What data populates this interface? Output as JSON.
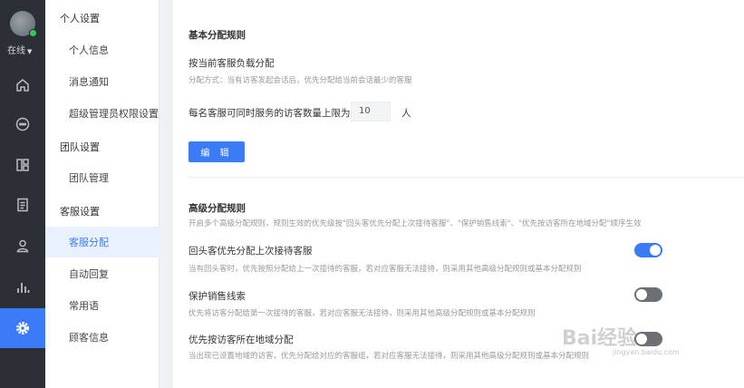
{
  "nav": {
    "status": "在线",
    "items": [
      "home-icon",
      "chat-icon",
      "dashboard-icon",
      "document-icon",
      "user-icon",
      "stats-icon",
      "settings-icon"
    ],
    "accent": "#3b7cf6"
  },
  "sidebar": {
    "groups": [
      {
        "label": "个人设置",
        "items": [
          "个人信息",
          "消息通知",
          "超级管理员权限设置"
        ]
      },
      {
        "label": "团队设置",
        "items": [
          "团队管理"
        ]
      },
      {
        "label": "客服设置",
        "items": [
          "客服分配",
          "自动回复",
          "常用语",
          "顾客信息"
        ]
      }
    ],
    "active": "客服分配"
  },
  "main": {
    "basic_title": "基本分配规则",
    "load_title": "按当前客服负载分配",
    "load_desc": "分配方式：当有访客发起会话后，优先分配给当前会话最少的客服",
    "limit_label": "每名客服可同时服务的访客数量上限为",
    "limit_value": "10",
    "limit_unit": "人",
    "edit_button": "编 辑",
    "advanced_title": "高级分配规则",
    "advanced_desc": "开启多个高级分配规则，规则生效的优先级按\"回头客优先分配上次接待客服\"、\"保护销售线索\"、\"优先按访客所在地域分配\"顺序生效",
    "rules": [
      {
        "title": "回头客优先分配上次接待客服",
        "desc": "当有回头客时，优先按照分配给上一次接待的客服，若对应客服无法接待，则采用其他高级分配规则或基本分配规则",
        "enabled": true
      },
      {
        "title": "保护销售线索",
        "desc": "优先将访客分配给第一次接待的客服，若对应客服无法接待，则采用其他高级分配规则或基本分配规则",
        "enabled": false
      },
      {
        "title": "优先按访客所在地域分配",
        "desc": "当出现已设置地域的访客，优先分配给对应的客服组，若对应客服无法接待，则采用其他高级分配规则或基本分配规则",
        "enabled": false
      }
    ]
  },
  "watermark": {
    "text": "Bai经验",
    "sub": "jingyan.baidu.com"
  }
}
